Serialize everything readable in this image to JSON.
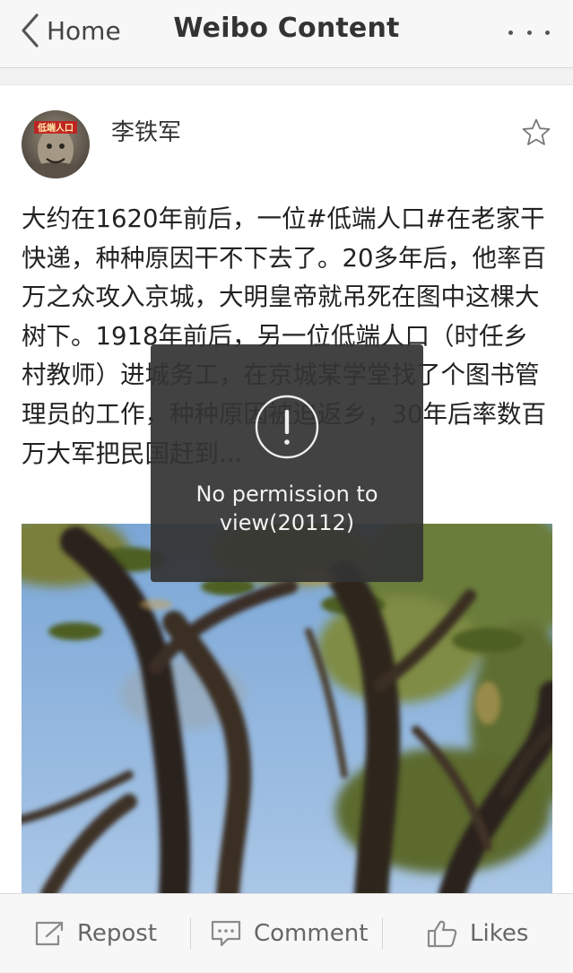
{
  "nav": {
    "back_label": "Home",
    "title": "Weibo Content"
  },
  "post": {
    "author": "李铁军",
    "avatar_badge_text": "低端人口",
    "text": "大约在1620年前后，一位#低端人口#在老家干快递，种种原因干不下去了。20多年后，他率百万之众攻入京城，大明皇帝就吊死在图中这棵大树下。1918年前后，另一位低端人口（时任乡村教师）进城务工，在京城某学堂找了个图书管理员的工作，种种原因被迫返乡，30年后率数百万大军把民国赶到...",
    "image_subject": "tree-photo"
  },
  "toast": {
    "message": "No permission to view(20112)"
  },
  "toolbar": {
    "repost": "Repost",
    "comment": "Comment",
    "likes": "Likes"
  },
  "colors": {
    "nav_bg": "#f7f7f7",
    "page_bg": "#f2f2f2",
    "toast_bg": "#343434",
    "text": "#222222"
  }
}
